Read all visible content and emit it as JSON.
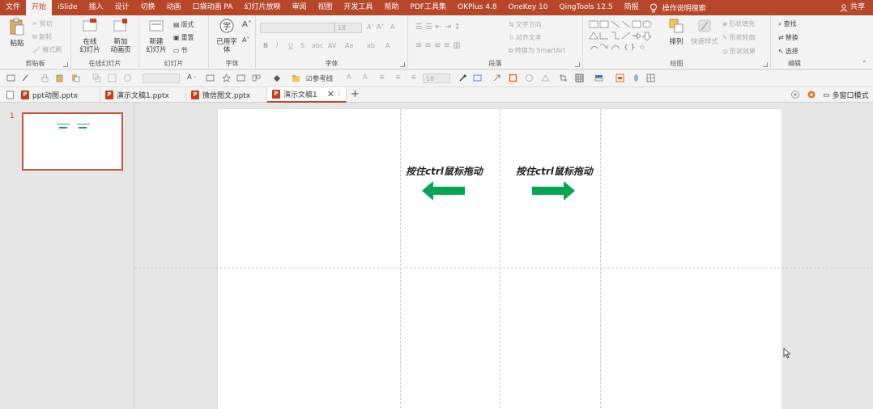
{
  "menu": {
    "tabs": [
      "文件",
      "开始",
      "iSlide",
      "插入",
      "设计",
      "切换",
      "动画",
      "口袋动画 PA",
      "幻灯片放映",
      "审阅",
      "视图",
      "开发工具",
      "帮助",
      "PDF工具集",
      "OKPlus 4.8",
      "OneKey 10",
      "QingTools 12.5",
      "简报"
    ],
    "active_tab": "开始",
    "tell_me": "操作说明搜索",
    "share": "共享"
  },
  "ribbon": {
    "clipboard": {
      "paste": "粘贴",
      "cut": "剪切",
      "copy": "复制",
      "format_painter": "格式刷",
      "label": "剪贴板"
    },
    "online_slides": {
      "online": "在线",
      "online2": "幻灯片",
      "new_anim": "新加",
      "new_anim2": "动画页",
      "label": "在线幻灯片"
    },
    "slides": {
      "new_slide": "新建",
      "new_slide2": "幻灯片",
      "layout": "版式",
      "reset": "重置",
      "section": "节",
      "label": "幻灯片"
    },
    "font_group": {
      "used_fonts": "已用字",
      "used_fonts2": "体",
      "label": "字体"
    },
    "font": {
      "size": "18",
      "label": "字体"
    },
    "paragraph": {
      "text_direction": "文字方向",
      "align_text": "对齐文本",
      "smartart": "转换为 SmartArt",
      "label": "段落"
    },
    "drawing": {
      "arrange": "排列",
      "quick_styles": "快速样式",
      "shape_fill": "形状填充",
      "shape_outline": "形状轮廓",
      "shape_effects": "形状效果",
      "label": "绘图"
    },
    "editing": {
      "find": "查找",
      "replace": "替换",
      "select": "选择",
      "label": "编辑"
    }
  },
  "qat": {
    "reference_line": "参考线",
    "font_size": "18"
  },
  "doc_tabs": [
    {
      "name": "ppt动图.pptx",
      "active": false
    },
    {
      "name": "演示文稿1.pptx",
      "active": false
    },
    {
      "name": "微信图文.pptx",
      "active": false
    },
    {
      "name": "演示文稿1",
      "active": true
    }
  ],
  "multi_window": "多窗口模式",
  "thumbnail": {
    "number": "1"
  },
  "slide": {
    "text_left": "按住ctrl鼠标拖动",
    "text_right": "按住ctrl鼠标拖动"
  },
  "colors": {
    "accent": "#b7472a",
    "arrow": "#00a651"
  }
}
